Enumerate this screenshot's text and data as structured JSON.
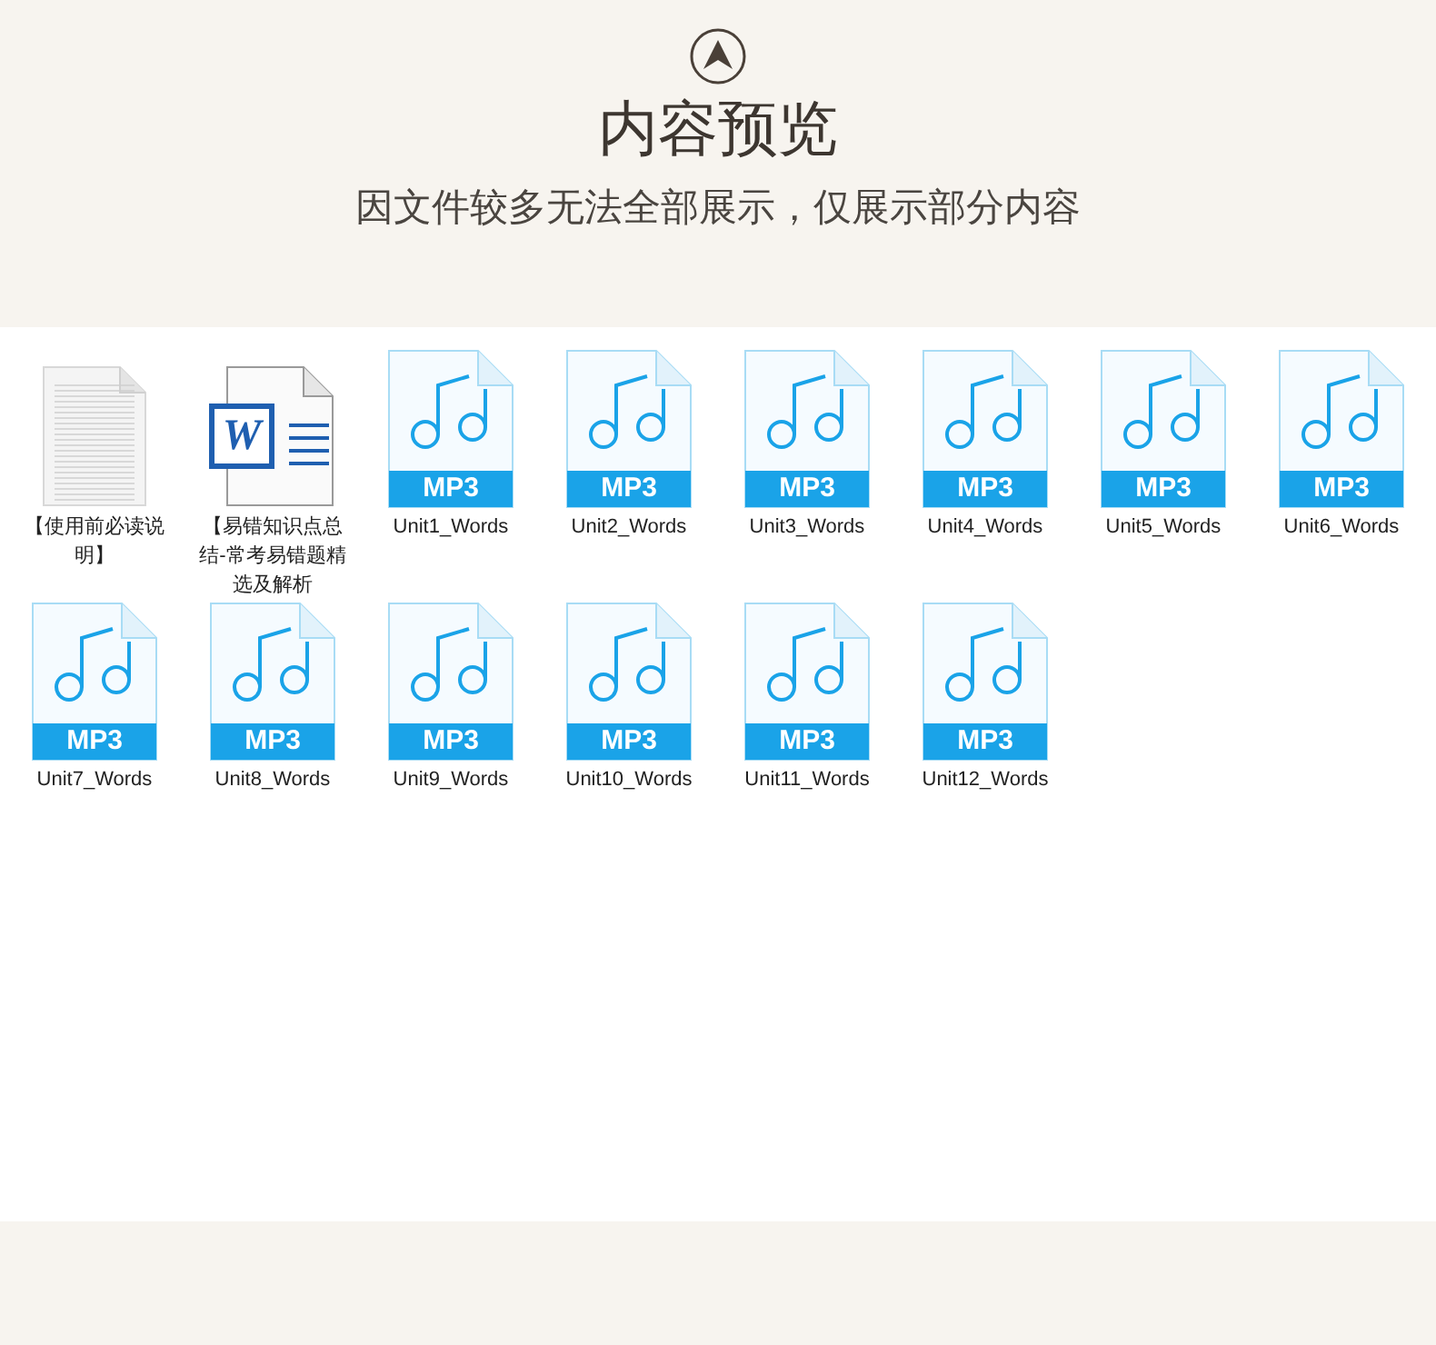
{
  "header": {
    "title": "内容预览",
    "subtitle": "因文件较多无法全部展示，仅展示部分内容"
  },
  "files": [
    {
      "kind": "text",
      "name": "【使用前必读说明】"
    },
    {
      "kind": "word",
      "badge": "W",
      "name": "【易错知识点总结-常考易错题精选及解析"
    },
    {
      "kind": "mp3",
      "badge": "MP3",
      "name": "Unit1_Words"
    },
    {
      "kind": "mp3",
      "badge": "MP3",
      "name": "Unit2_Words"
    },
    {
      "kind": "mp3",
      "badge": "MP3",
      "name": "Unit3_Words"
    },
    {
      "kind": "mp3",
      "badge": "MP3",
      "name": "Unit4_Words"
    },
    {
      "kind": "mp3",
      "badge": "MP3",
      "name": "Unit5_Words"
    },
    {
      "kind": "mp3",
      "badge": "MP3",
      "name": "Unit6_Words"
    },
    {
      "kind": "mp3",
      "badge": "MP3",
      "name": "Unit7_Words"
    },
    {
      "kind": "mp3",
      "badge": "MP3",
      "name": "Unit8_Words"
    },
    {
      "kind": "mp3",
      "badge": "MP3",
      "name": "Unit9_Words"
    },
    {
      "kind": "mp3",
      "badge": "MP3",
      "name": "Unit10_Words"
    },
    {
      "kind": "mp3",
      "badge": "MP3",
      "name": "Unit11_Words"
    },
    {
      "kind": "mp3",
      "badge": "MP3",
      "name": "Unit12_Words"
    }
  ]
}
